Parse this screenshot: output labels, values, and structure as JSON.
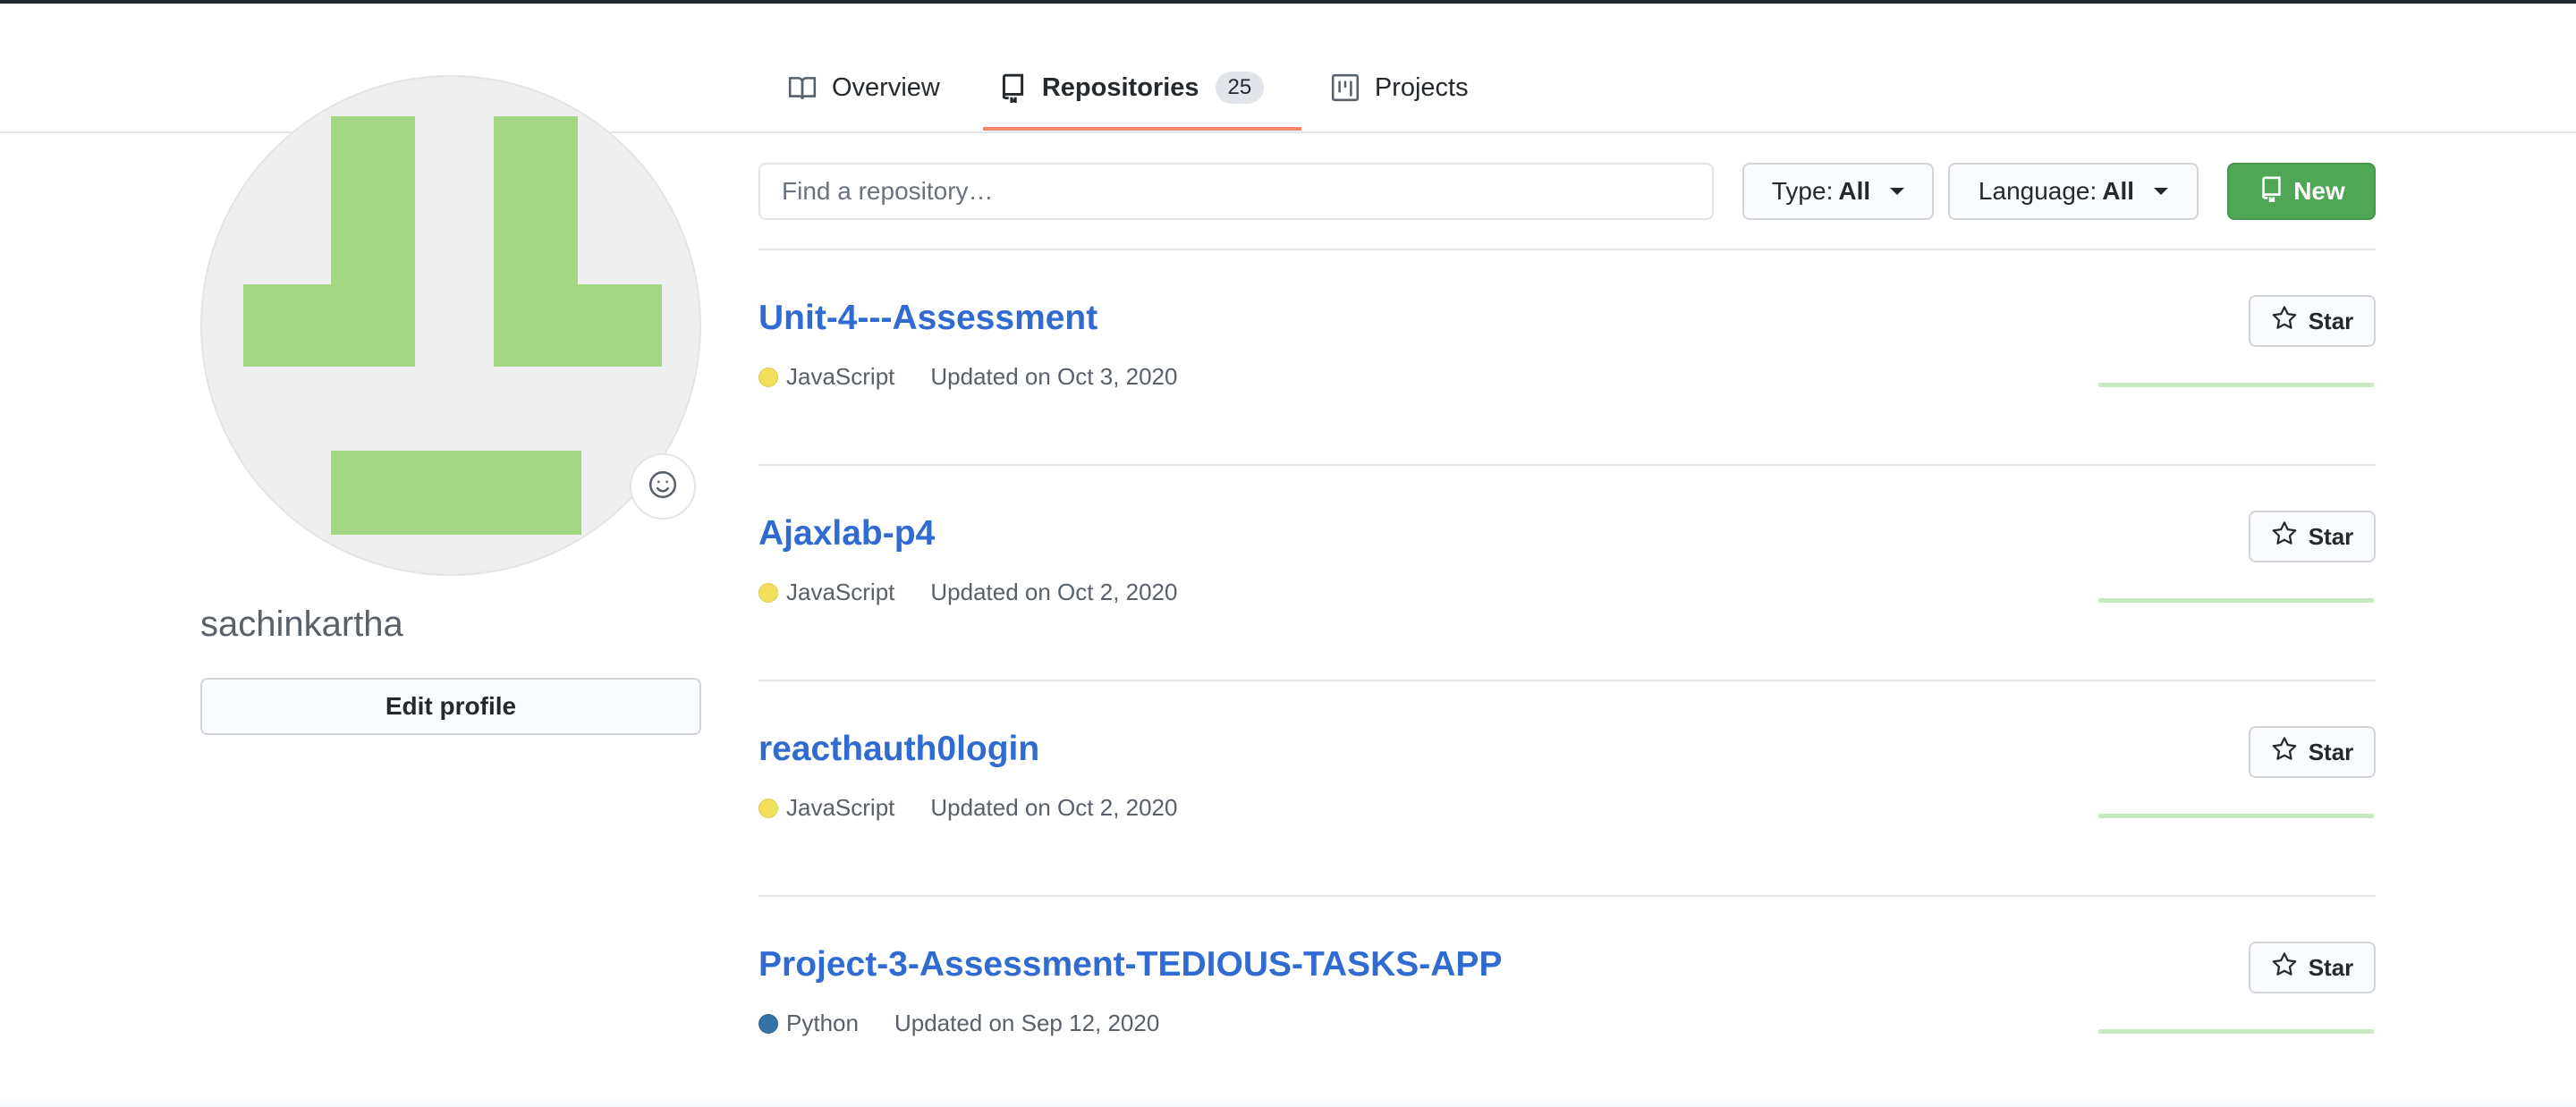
{
  "nav": {
    "tabs": [
      {
        "label": "Overview",
        "icon": "book-icon"
      },
      {
        "label": "Repositories",
        "icon": "repo-icon",
        "count": "25",
        "selected": true
      },
      {
        "label": "Projects",
        "icon": "project-icon"
      }
    ]
  },
  "profile": {
    "username": "sachinkartha",
    "edit_label": "Edit profile",
    "avatar_color": "#a2d682"
  },
  "toolbar": {
    "search_placeholder": "Find a repository…",
    "type_label": "Type:",
    "type_value": "All",
    "language_label": "Language:",
    "language_value": "All",
    "new_label": "New",
    "new_color": "#4fa654"
  },
  "repos": [
    {
      "name": "Unit-4---Assessment",
      "language": "JavaScript",
      "language_color": "#f1e05a",
      "updated": "Updated on Oct 3, 2020",
      "star_label": "Star"
    },
    {
      "name": "Ajaxlab-p4",
      "language": "JavaScript",
      "language_color": "#f1e05a",
      "updated": "Updated on Oct 2, 2020",
      "star_label": "Star"
    },
    {
      "name": "reacthauth0login",
      "language": "JavaScript",
      "language_color": "#f1e05a",
      "updated": "Updated on Oct 2, 2020",
      "star_label": "Star"
    },
    {
      "name": "Project-3-Assessment-TEDIOUS-TASKS-APP",
      "language": "Python",
      "language_color": "#3572a5",
      "updated": "Updated on Sep 12, 2020",
      "star_label": "Star"
    }
  ]
}
